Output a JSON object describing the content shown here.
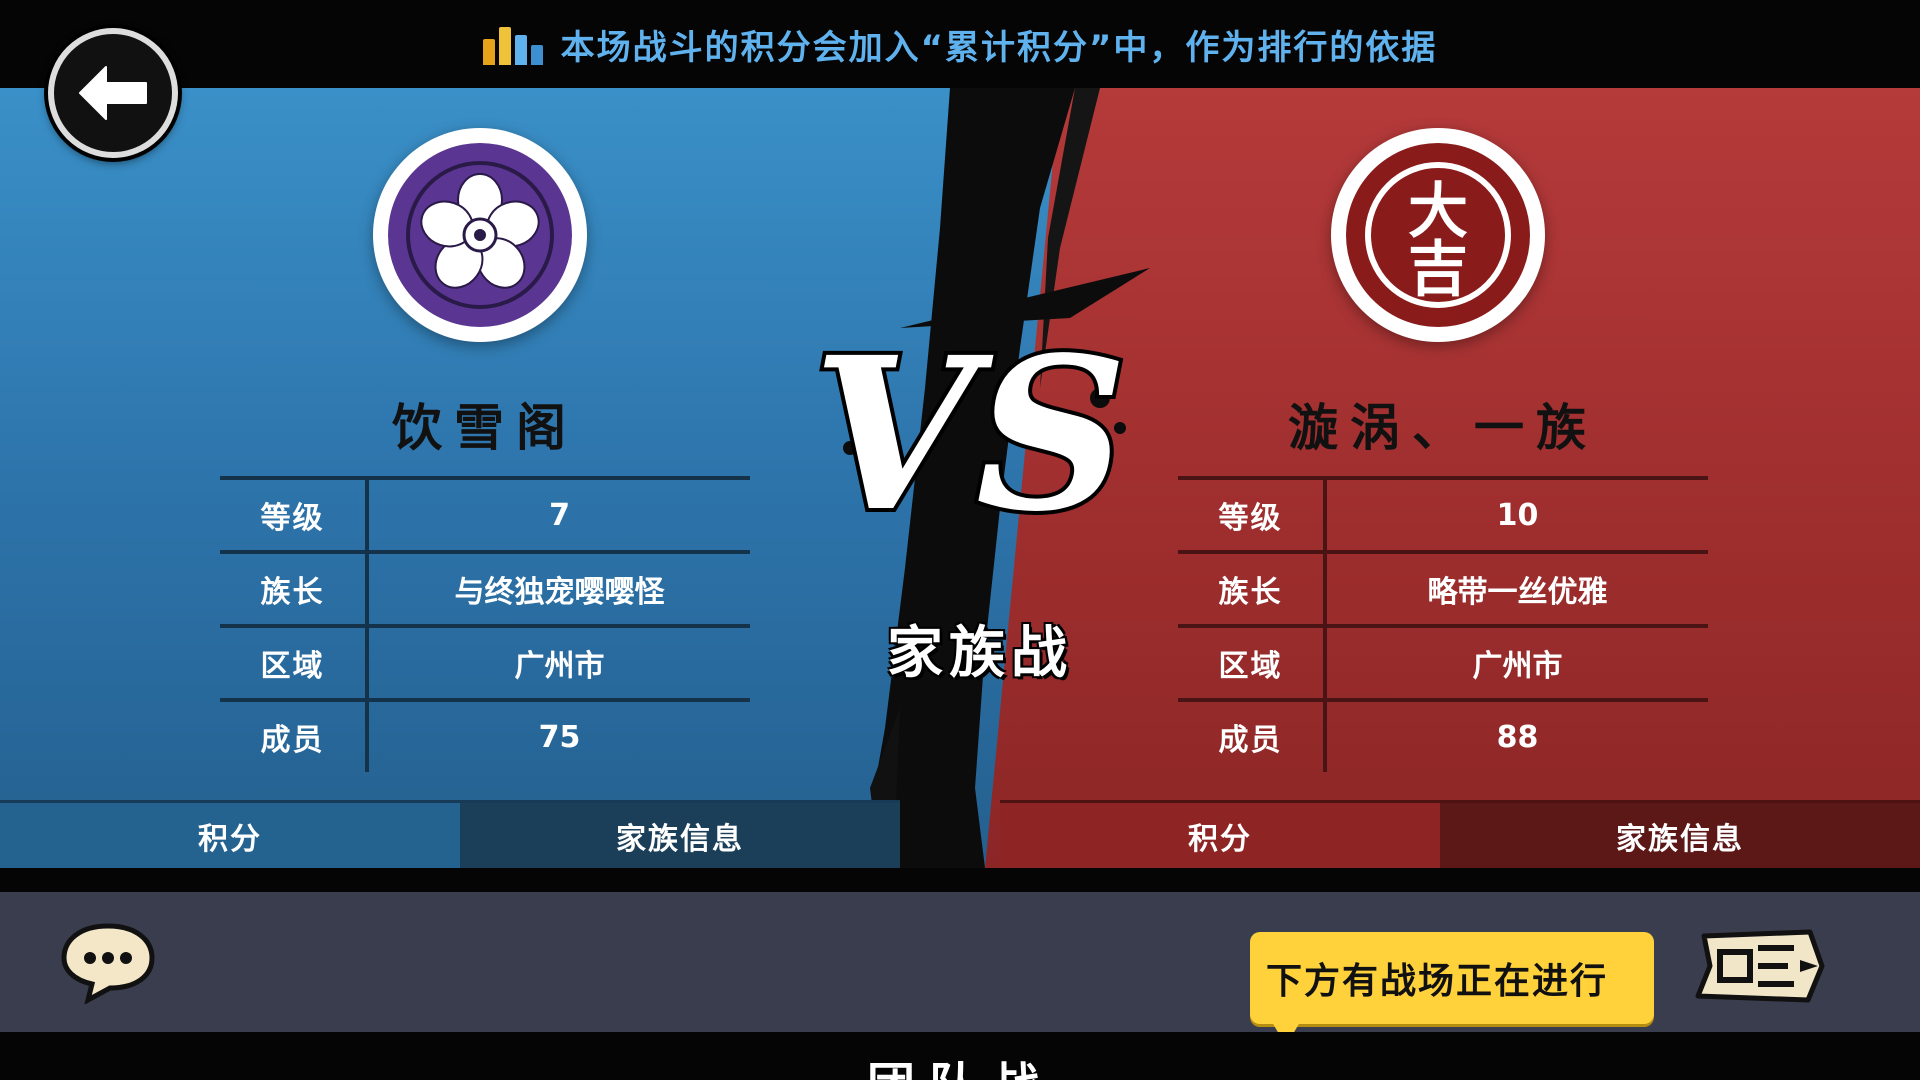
{
  "notice": {
    "text": "本场战斗的积分会加入“累计积分”中，作为排行的依据",
    "icon": "bar-chart-icon",
    "bar_colors": [
      "#e7a21c",
      "#f0c23a",
      "#5fb2ee",
      "#3d8fd0"
    ]
  },
  "nav": {
    "back_icon": "back-arrow-icon"
  },
  "left_team": {
    "name": "饮雪阁",
    "emblem": "purple-flower-crest",
    "emblem_color": "#5a3592",
    "rows": [
      {
        "label": "等级",
        "value": "7"
      },
      {
        "label": "族长",
        "value": "与终独宠嘤嘤怪"
      },
      {
        "label": "区域",
        "value": "广州市"
      },
      {
        "label": "成员",
        "value": "75"
      }
    ],
    "tabs": {
      "score": "积分",
      "info": "家族信息"
    }
  },
  "right_team": {
    "name": "漩涡、一族",
    "emblem": "daikichi-crest",
    "emblem_text_top": "大",
    "emblem_text_bottom": "吉",
    "emblem_color": "#8a1b1b",
    "rows": [
      {
        "label": "等级",
        "value": "10"
      },
      {
        "label": "族长",
        "value": "略带一丝优雅"
      },
      {
        "label": "区域",
        "value": "广州市"
      },
      {
        "label": "成员",
        "value": "88"
      }
    ],
    "tabs": {
      "score": "积分",
      "info": "家族信息"
    }
  },
  "versus": {
    "vs": "VS",
    "mode": "家族战"
  },
  "bottom": {
    "chat_icon": "chat-bubble-icon",
    "battle_tip": "下方有战场正在进行",
    "battle_icon": "battle-scroll-icon",
    "footer_label": "团队战"
  },
  "colors": {
    "blue_panel": "#2d74ab",
    "red_panel": "#a12f2f",
    "tip_yellow": "#ffd23c"
  }
}
